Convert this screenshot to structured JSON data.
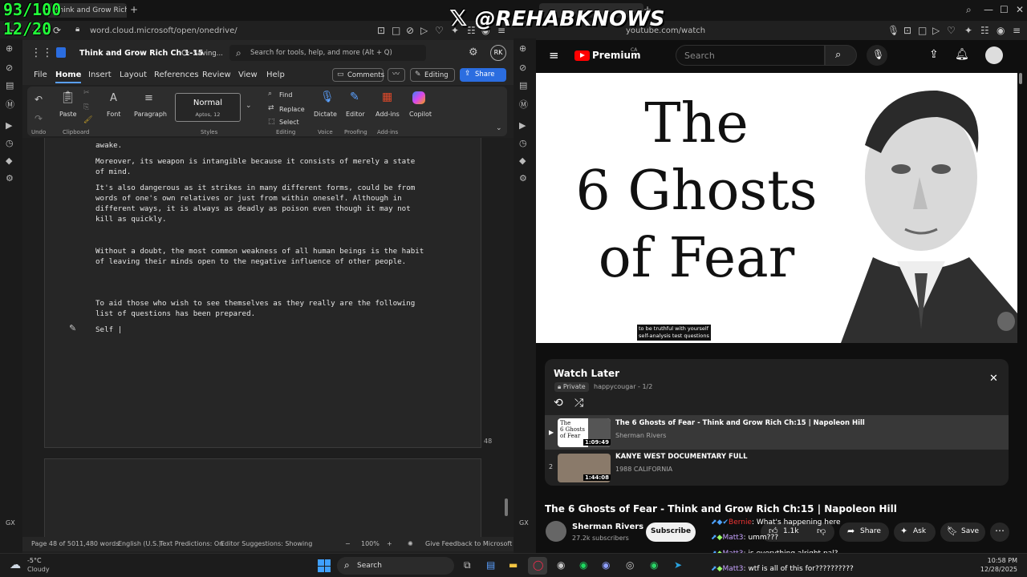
{
  "overlay": {
    "counter1": "93/100",
    "counter2": "12/20",
    "handle": "@REHABKNOWS"
  },
  "left_browser": {
    "tab_title": "Think and Grow Rich Ch 1",
    "url": "word.cloud.microsoft/open/onedrive/"
  },
  "word": {
    "doc_title": "Think and Grow Rich Ch 1-15",
    "save_status": "Saving...",
    "search_placeholder": "Search for tools, help, and more (Alt + Q)",
    "avatar": "RK",
    "menu": [
      "File",
      "Home",
      "Insert",
      "Layout",
      "References",
      "Review",
      "View",
      "Help"
    ],
    "comments": "Comments",
    "editing": "Editing",
    "share": "Share",
    "ribbon": {
      "undo": "Undo",
      "paste": "Paste",
      "clipboard": "Clipboard",
      "font": "Font",
      "paragraph": "Paragraph",
      "style_name": "Normal",
      "style_font": "Aptos, 12",
      "styles": "Styles",
      "find": "Find",
      "replace": "Replace",
      "select": "Select",
      "editing_group": "Editing",
      "dictate": "Dictate",
      "voice": "Voice",
      "editor": "Editor",
      "proofing": "Proofing",
      "addins": "Add-ins",
      "addins_group": "Add-ins",
      "copilot": "Copilot"
    },
    "doc": {
      "p0": "awake.",
      "p1": "Moreover, its weapon is intangible because it consists of merely a state of mind.",
      "p2": "It's also dangerous as it strikes in many different forms, could be from words of one's own relatives or just from within oneself. Although in different ways, it is always as deadly as poison even though it may not kill as quickly.",
      "p3": "Without a doubt, the most common weakness of all human beings is the habit of leaving their minds open to the negative influence of other people.",
      "p4": "To aid those who wish to see themselves as they really are the following list of questions has been prepared.",
      "p5": "Self |",
      "page_number": "48"
    },
    "status": {
      "page": "Page 48 of 50",
      "words": "11,480 words",
      "lang": "English (U.S.)",
      "predictions": "Text Predictions: On",
      "suggestions": "Editor Suggestions: Showing",
      "zoom": "100%",
      "feedback": "Give Feedback to Microsoft"
    }
  },
  "right_browser": {
    "url": "youtube.com/watch",
    "logo": "Premium",
    "logo_region": "CA",
    "search_placeholder": "Search"
  },
  "video": {
    "line1": "The",
    "line2": "6 Ghosts",
    "line3": "of Fear",
    "caption1": "to be truthful with yourself",
    "caption2": "self-analysis test questions"
  },
  "watch_later": {
    "title": "Watch Later",
    "privacy": "Private",
    "owner": "happycougar - 1/2",
    "items": [
      {
        "index": "▶",
        "title": "The 6 Ghosts of Fear - Think and Grow Rich Ch:15 | Napoleon Hill",
        "channel": "Sherman Rivers",
        "duration": "1:09:49"
      },
      {
        "index": "2",
        "title": "KANYE WEST DOCUMENTARY FULL",
        "channel": "1988 CALIFORNIA",
        "duration": "1:44:08"
      }
    ]
  },
  "video_info": {
    "title": "The 6 Ghosts of Fear - Think and Grow Rich Ch:15 | Napoleon Hill",
    "channel": "Sherman Rivers",
    "subscribers": "27.2k subscribers",
    "subscribe": "Subscribe",
    "likes": "1.1k",
    "share": "Share",
    "ask": "Ask",
    "save": "Save"
  },
  "chat": [
    {
      "user": "Bernie",
      "msg": ": What's happening here"
    },
    {
      "user": "Matt3",
      "msg": ": umm???"
    },
    {
      "user": "Matt3",
      "msg": ": is everything alright pal?"
    },
    {
      "user": "Matt3",
      "msg": ": wtf is all of this for??????????"
    }
  ],
  "taskbar": {
    "temp": "-5°C",
    "weather": "Cloudy",
    "search": "Search",
    "time": "10:58 PM",
    "date": "12/28/2025"
  },
  "colors": {
    "accent": "#3b82f6",
    "counter": "#23ff3a",
    "yt_red": "#ff0000"
  }
}
